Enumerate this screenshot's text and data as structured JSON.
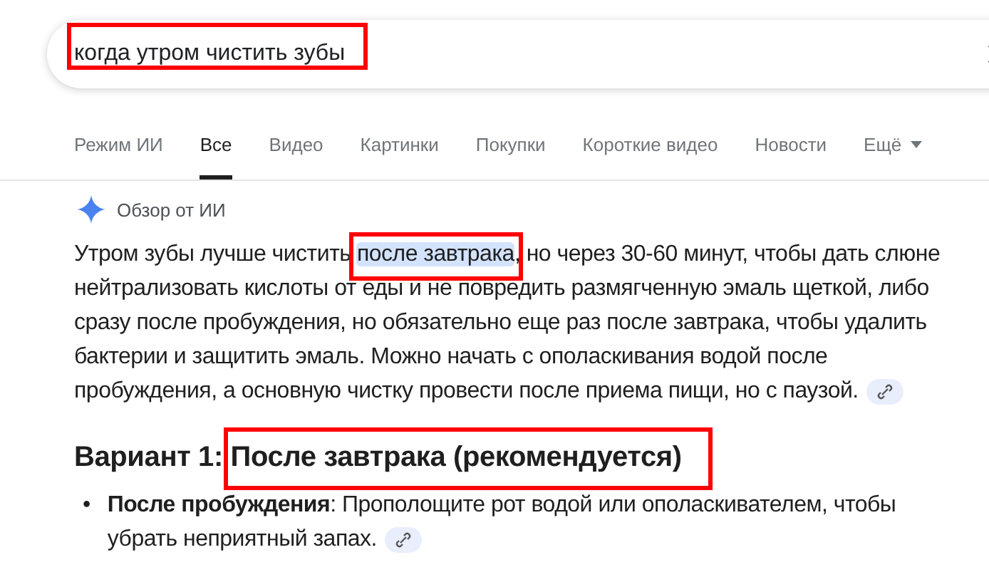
{
  "search": {
    "query": "когда утром чистить зубы",
    "query_framed": true
  },
  "tabs": [
    {
      "label": "Режим ИИ",
      "selected": false,
      "kind": "plain"
    },
    {
      "label": "Все",
      "selected": true,
      "kind": "plain"
    },
    {
      "label": "Видео",
      "selected": false,
      "kind": "plain"
    },
    {
      "label": "Картинки",
      "selected": false,
      "kind": "plain"
    },
    {
      "label": "Покупки",
      "selected": false,
      "kind": "plain"
    },
    {
      "label": "Короткие видео",
      "selected": false,
      "kind": "plain"
    },
    {
      "label": "Новости",
      "selected": false,
      "kind": "plain"
    },
    {
      "label": "Ещё",
      "selected": false,
      "kind": "menu"
    }
  ],
  "ai_overview": {
    "title": "Обзор от ИИ",
    "paragraph": [
      {
        "text": "Утром зубы лучше чистить ",
        "highlighted": false,
        "framed": false
      },
      {
        "text": "после завтрака",
        "highlighted": true,
        "framed": true
      },
      {
        "text": ", но через 30-60 минут, чтобы дать слюне нейтрализовать кислоты от еды и не повредить размягченную эмаль щеткой, либо сразу после пробуждения, но обязательно еще раз после завтрака, чтобы удалить бактерии и защитить эмаль. Можно начать с ополаскивания водой после пробуждения, а основную чистку провести после приема пищи, но с паузой.",
        "highlighted": false,
        "framed": false
      }
    ],
    "heading": [
      {
        "text": "Вариант 1: ",
        "framed": false
      },
      {
        "text": "После завтрака (рекомендуется)",
        "framed": true
      }
    ],
    "bullets": [
      {
        "marker": "•",
        "text": "**После пробуждения**: Прополощите рот водой или ополаскивателем, чтобы убрать неприятный запах."
      }
    ]
  }
}
